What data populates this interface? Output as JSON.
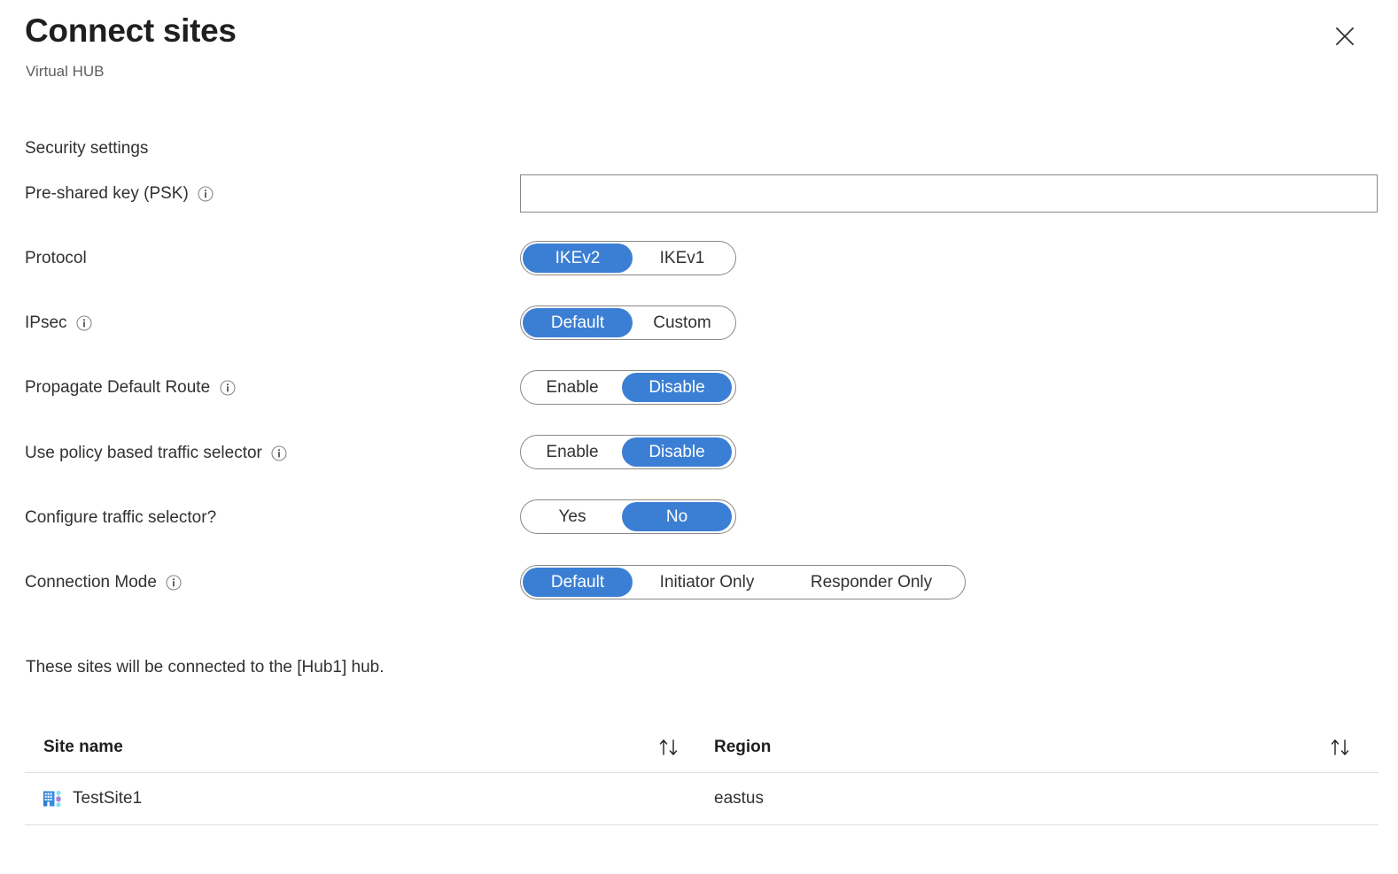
{
  "header": {
    "title": "Connect sites",
    "subtitle": "Virtual HUB",
    "close_label": "Close"
  },
  "section": {
    "title": "Security settings"
  },
  "fields": {
    "psk": {
      "label": "Pre-shared key (PSK)",
      "value": "",
      "placeholder": "",
      "has_info": true
    },
    "protocol": {
      "label": "Protocol",
      "has_info": false,
      "options": [
        "IKEv2",
        "IKEv1"
      ],
      "selected": "IKEv2"
    },
    "ipsec": {
      "label": "IPsec",
      "has_info": true,
      "options": [
        "Default",
        "Custom"
      ],
      "selected": "Default"
    },
    "propagate_default_route": {
      "label": "Propagate Default Route",
      "has_info": true,
      "options": [
        "Enable",
        "Disable"
      ],
      "selected": "Disable"
    },
    "policy_based_traffic_selector": {
      "label": "Use policy based traffic selector",
      "has_info": true,
      "options": [
        "Enable",
        "Disable"
      ],
      "selected": "Disable"
    },
    "configure_traffic_selector": {
      "label": "Configure traffic selector?",
      "has_info": false,
      "options": [
        "Yes",
        "No"
      ],
      "selected": "No"
    },
    "connection_mode": {
      "label": "Connection Mode",
      "has_info": true,
      "options": [
        "Default",
        "Initiator Only",
        "Responder Only"
      ],
      "selected": "Default"
    }
  },
  "hub_note": "These sites will be connected to the [Hub1] hub.",
  "table": {
    "columns": [
      "Site name",
      "Region"
    ],
    "rows": [
      {
        "site_name": "TestSite1",
        "region": "eastus",
        "icon": "vpn-site-icon"
      }
    ]
  },
  "colors": {
    "accent": "#3b7fd4",
    "text": "#323130",
    "title": "#201f1e",
    "subtle_text": "#605e5c",
    "border": "#8a8886",
    "divider": "#e1dfdd",
    "background": "#ffffff"
  }
}
